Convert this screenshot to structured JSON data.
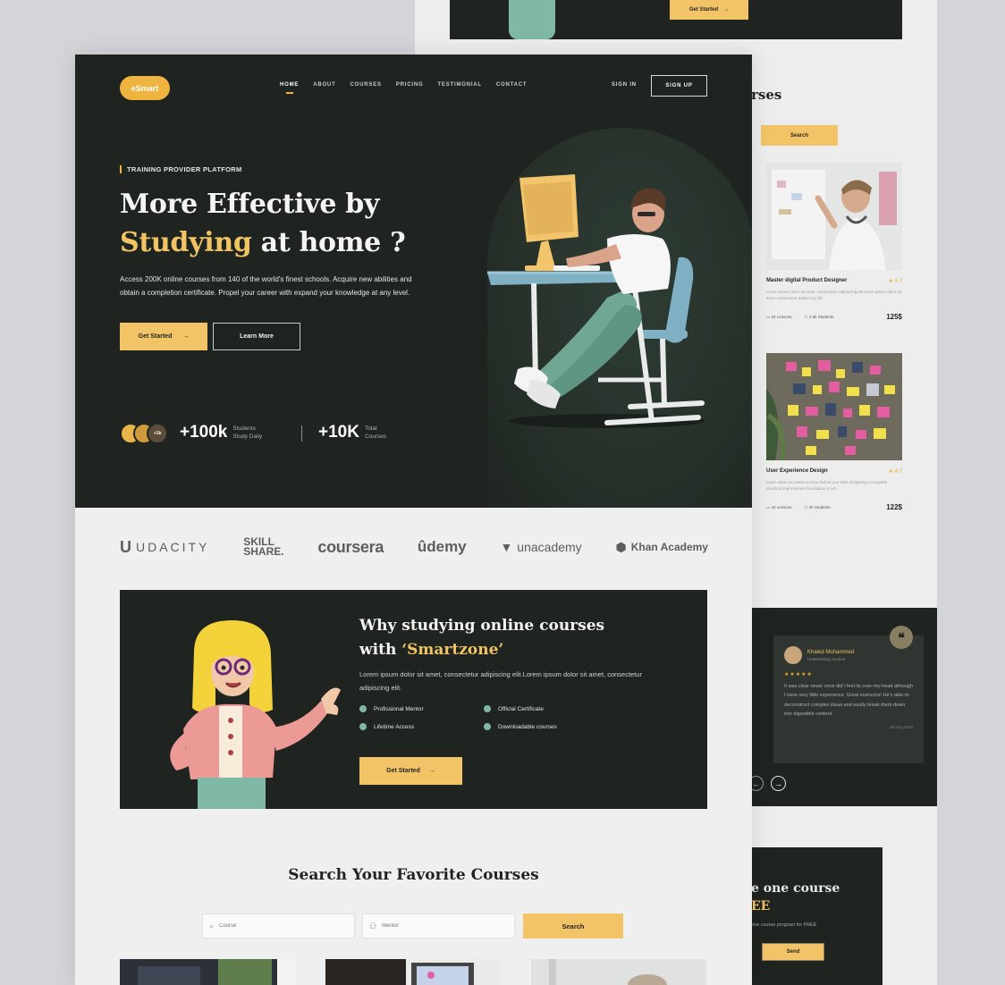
{
  "back_page": {
    "hero_button": "Get Started",
    "section_title_fragment": "rses",
    "search_button": "Search",
    "courses": [
      {
        "title": "Master digital Product Designer",
        "rating": "4.7",
        "desc": "Lorem ipsum dolor sit amet, consectetur adipiscing elit lorem ipsum dolor sit amet consectetur adipiscing elit",
        "lessons": "34 Lessons",
        "students": "2.5k Students",
        "price": "125$"
      },
      {
        "title": "User Experience Design",
        "rating": "4.7",
        "desc": "Learn what you need to know before you start designing A complete practical improvement foundation in UX",
        "lessons": "42 Lessons",
        "students": "4k Students",
        "price": "122$"
      }
    ],
    "testimonial": {
      "name": "Khaled Mohammed",
      "role": "UI/Marketing Student",
      "stars": "★★★★★",
      "quote": "It was clear never once did I feel its over-my-head although I have very little experience. Great instructor! He's able to deconstruct complex ideas and easily break them down into digestible content.",
      "date": "1st Aug 2022",
      "quote_mark": "❝"
    },
    "free": {
      "title_fragment": "e one course",
      "title2_fragment": "EE",
      "subtitle_fragment": "one course program for FREE",
      "send_button": "Send"
    }
  },
  "header": {
    "logo": "eSmart",
    "nav": [
      "HOME",
      "ABOUT",
      "COURSES",
      "PRICING",
      "TESTIMONIAL",
      "CONTACT"
    ],
    "active_nav": "HOME",
    "sign_in": "SIGN IN",
    "sign_up": "SIGN UP"
  },
  "hero": {
    "eyebrow": "TRAINING PROVIDER PLATFORM",
    "title_line1": "More Effective by",
    "title_accent": "Studying",
    "title_line2_rest": " at home ?",
    "description": "Access 200K online courses from 140 of the world's finest schools. Acquire new abilities and obtain a completion certificate. Propel your career with expand your knowledge at any level.",
    "primary_button": "Get Started",
    "secondary_button": "Learn More",
    "avatar_badge": "+1k",
    "stats": [
      {
        "value": "+100k",
        "label_line1": "Students",
        "label_line2": "Study Daily"
      },
      {
        "value": "+10K",
        "label_line1": "Total",
        "label_line2": "Courses"
      }
    ]
  },
  "brands": [
    "UDACITY",
    "SKILL",
    "SHARE.",
    "coursera",
    "ûdemy",
    "unacademy",
    "Khan Academy"
  ],
  "why": {
    "title_line1": "Why studying online courses",
    "title_line2_prefix": "with ",
    "title_accent": "‘Smartzone’",
    "description": "Lorem ipsum dolor sit amet, consectetur adipiscing elit.Lorem ipsum dolor sit amet, consectetur adipiscing elit.",
    "features": [
      "Profissional Mentor",
      "Official Certificate",
      "Lifetime Access",
      "Downloadable courses"
    ],
    "button": "Get Started"
  },
  "search": {
    "title": "Search Your Favorite Courses",
    "course_placeholder": "Course",
    "mentor_placeholder": "Mentor",
    "button": "Search"
  },
  "colors": {
    "dark": "#1f2420",
    "accent": "#f3c467",
    "light": "#efefef",
    "teal": "#7fb8a4"
  }
}
